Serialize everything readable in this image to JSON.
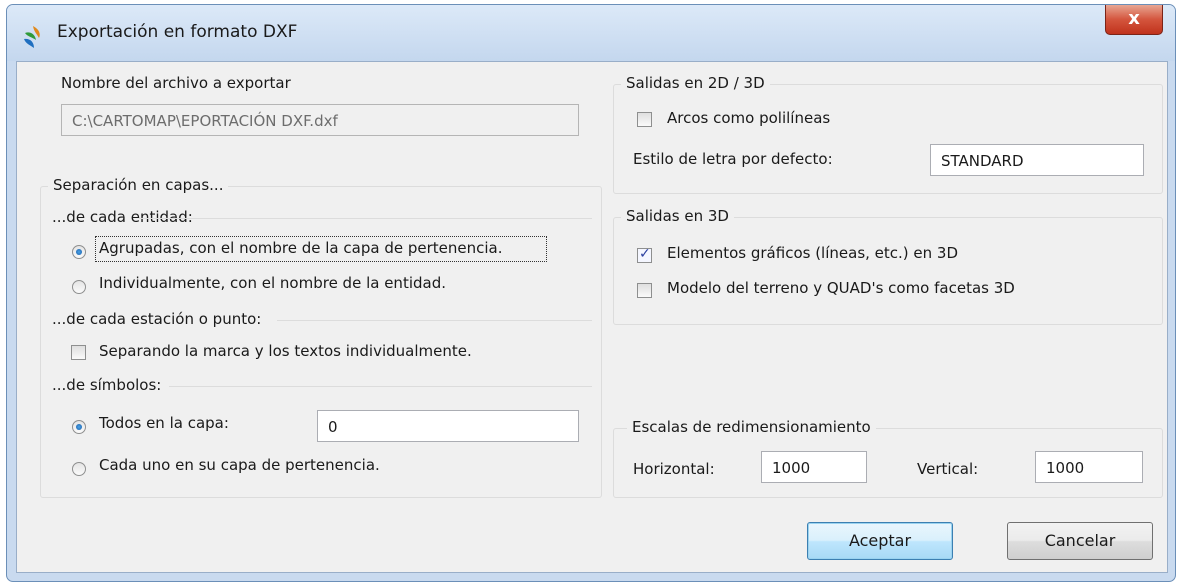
{
  "window": {
    "title": "Exportación en formato DXF",
    "close_label": "x"
  },
  "file": {
    "label": "Nombre del archivo a exportar",
    "path": "C:\\CARTOMAP\\EPORTACIÓN DXF.dxf"
  },
  "layers": {
    "title": "Separación en capas...",
    "entity": {
      "header": "...de cada entidad:",
      "grouped": "Agrupadas, con el nombre de la  capa de pertenencia.",
      "individual": "Individualmente, con el nombre de la entidad.",
      "selected": "grouped"
    },
    "station": {
      "header": "...de cada estación o punto:",
      "separate": "Separando la marca y los textos individualmente.",
      "separate_checked": false
    },
    "symbols": {
      "header": "...de símbolos:",
      "all_in_layer": "Todos en la capa:",
      "all_in_layer_value": "0",
      "each_own": "Cada uno en su capa de pertenencia.",
      "selected": "all_in_layer"
    }
  },
  "out2d3d": {
    "title": "Salidas en 2D / 3D",
    "arcs": "Arcos como polilíneas",
    "arcs_checked": false,
    "font_label": "Estilo de letra por defecto:",
    "font_value": "STANDARD"
  },
  "out3d": {
    "title": "Salidas en 3D",
    "elements": "Elementos gráficos (líneas, etc.) en 3D",
    "elements_checked": true,
    "terrain": "Modelo del terreno y QUAD's como facetas 3D",
    "terrain_checked": false
  },
  "scales": {
    "title": "Escalas de redimensionamiento",
    "horizontal_label": "Horizontal:",
    "horizontal_value": "1000",
    "vertical_label": "Vertical:",
    "vertical_value": "1000"
  },
  "buttons": {
    "ok": "Aceptar",
    "cancel": "Cancelar"
  },
  "colors": {
    "accent": "#3c7fb1",
    "title_bar": "#c9daef",
    "close": "#c0321c"
  }
}
